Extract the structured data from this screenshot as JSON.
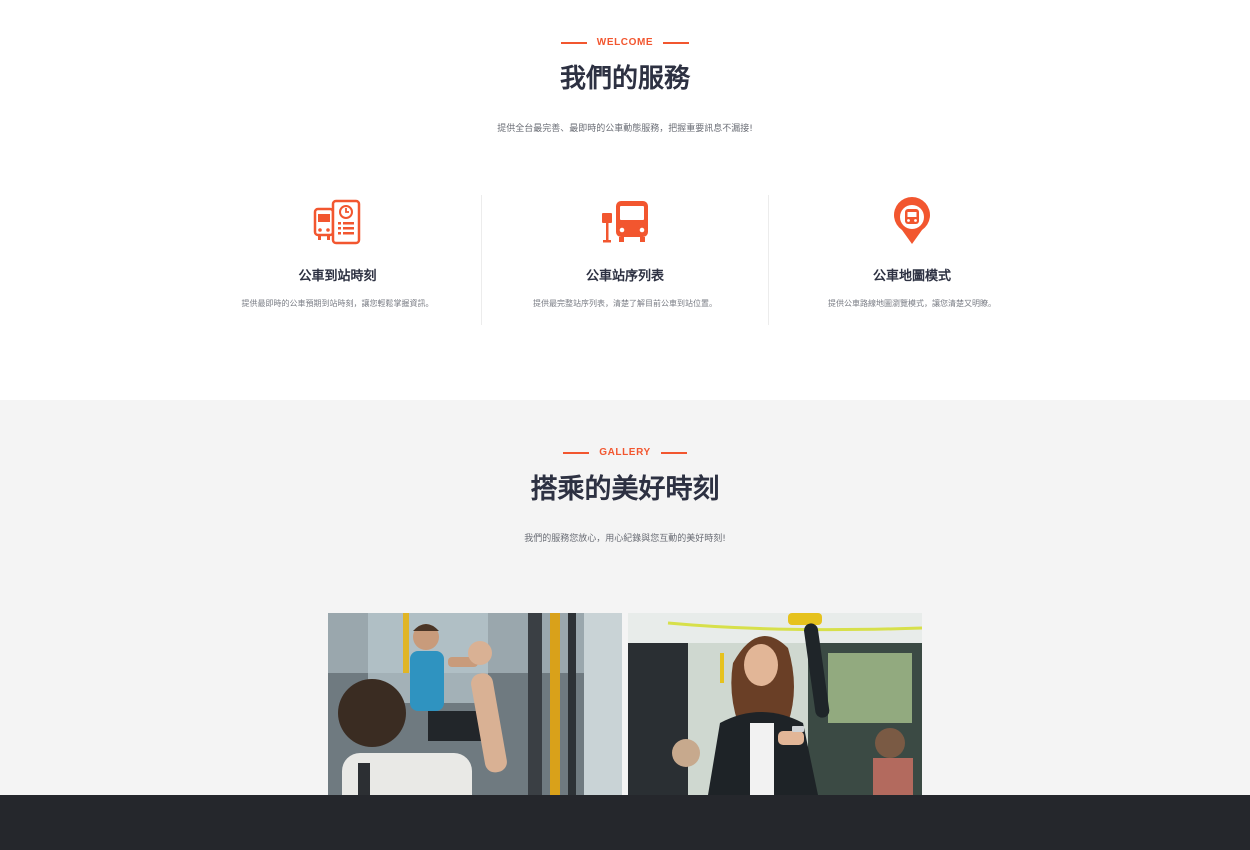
{
  "welcome": {
    "eyebrow": "WELCOME",
    "title": "我們的服務",
    "subtitle": "提供全台最完善、最即時的公車動態服務，把握重要訊息不漏接!",
    "features": [
      {
        "icon": "bus-arrival-schedule-icon",
        "title": "公車到站時刻",
        "desc": "提供最即時的公車預期到站時刻，讓您輕鬆掌握資訊。"
      },
      {
        "icon": "bus-stop-icon",
        "title": "公車站序列表",
        "desc": "提供最完整站序列表，清楚了解目前公車到站位置。"
      },
      {
        "icon": "bus-map-pin-icon",
        "title": "公車地圖模式",
        "desc": "提供公車路線地圖瀏覽模式，讓您清楚又明瞭。"
      }
    ]
  },
  "gallery": {
    "eyebrow": "GALLERY",
    "title": "搭乘的美好時刻",
    "subtitle": "我們的服務您放心，用心紀錄與您互動的美好時刻!"
  },
  "colors": {
    "accent": "#f2562f",
    "title": "#2d3142",
    "gallery_bg": "#f4f4f4",
    "footer": "#25272c"
  }
}
